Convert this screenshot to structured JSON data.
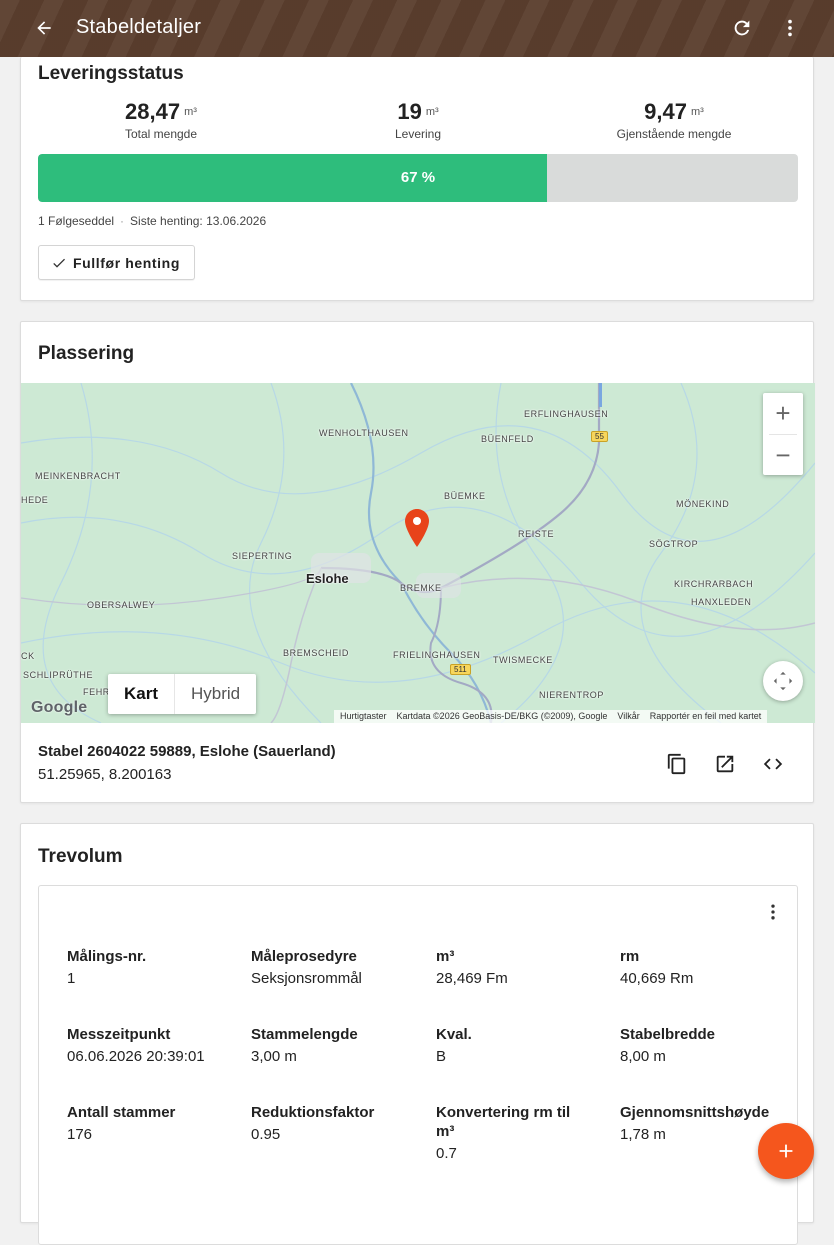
{
  "appbar": {
    "title": "Stabeldetaljer"
  },
  "delivery": {
    "title": "Leveringsstatus",
    "stats": [
      {
        "value": "28,47",
        "unit": "m³",
        "label": "Total mengde"
      },
      {
        "value": "19",
        "unit": "m³",
        "label": "Levering"
      },
      {
        "value": "9,47",
        "unit": "m³",
        "label": "Gjenstående mengde"
      }
    ],
    "progress_percent": 67,
    "progress_label": "67 %",
    "delivery_notes": "1 Følgeseddel",
    "last_pickup": "Siste henting: 13.06.2026",
    "complete_button": "Fullfør henting"
  },
  "location": {
    "title": "Plassering",
    "map": {
      "places": [
        "ERFLINGHAUSEN",
        "WENHOLTHAUSEN",
        "BÜENFELD",
        "MEINKENBRACHT",
        "HEDE",
        "BÜEMKE",
        "MÖNEKIND",
        "REISTE",
        "SÖGTROP",
        "SIEPERTING",
        "Eslohe",
        "BREMKE",
        "KIRCHRARBACH",
        "HANXLEDEN",
        "OBERSALWEY",
        "CK",
        "BREMSCHEID",
        "FRIELINGHAUSEN",
        "TWISMECKE",
        "SCHLIPRÜTHE",
        "FEHR",
        "NIERENTROP"
      ],
      "road_shields": [
        "55",
        "511"
      ],
      "map_type_options": [
        "Kart",
        "Hybrid"
      ],
      "selected_map_type": "Kart",
      "provider": "Google",
      "attribution": [
        "Hurtigtaster",
        "Kartdata ©2026 GeoBasis-DE/BKG (©2009), Google",
        "Vilkår",
        "Rapportér en feil med kartet"
      ]
    },
    "name": "Stabel 2604022 59889, Eslohe (Sauerland)",
    "coords": "51.25965, 8.200163"
  },
  "volume": {
    "title": "Trevolum",
    "fields": [
      {
        "key": "Målings-nr.",
        "value": "1"
      },
      {
        "key": "Måleprosedyre",
        "value": "Seksjonsrommål"
      },
      {
        "key": "m³",
        "value": "28,469 Fm"
      },
      {
        "key": "rm",
        "value": "40,669 Rm"
      },
      {
        "key": "Messzeitpunkt",
        "value": "06.06.2026 20:39:01"
      },
      {
        "key": "Stammelengde",
        "value": "3,00 m"
      },
      {
        "key": "Kval.",
        "value": "B"
      },
      {
        "key": "Stabelbredde",
        "value": "8,00 m"
      },
      {
        "key": "Antall stammer",
        "value": "176"
      },
      {
        "key": "Reduktionsfaktor",
        "value": "0.95"
      },
      {
        "key": "Konvertering rm til m³",
        "value": "0.7"
      },
      {
        "key": "Gjennomsnittshøyde",
        "value": "1,78 m"
      }
    ]
  },
  "colors": {
    "appbar": "#5b3e2e",
    "progress": "#2ebd7c",
    "fab": "#f5561d",
    "pin": "#e8431a"
  }
}
